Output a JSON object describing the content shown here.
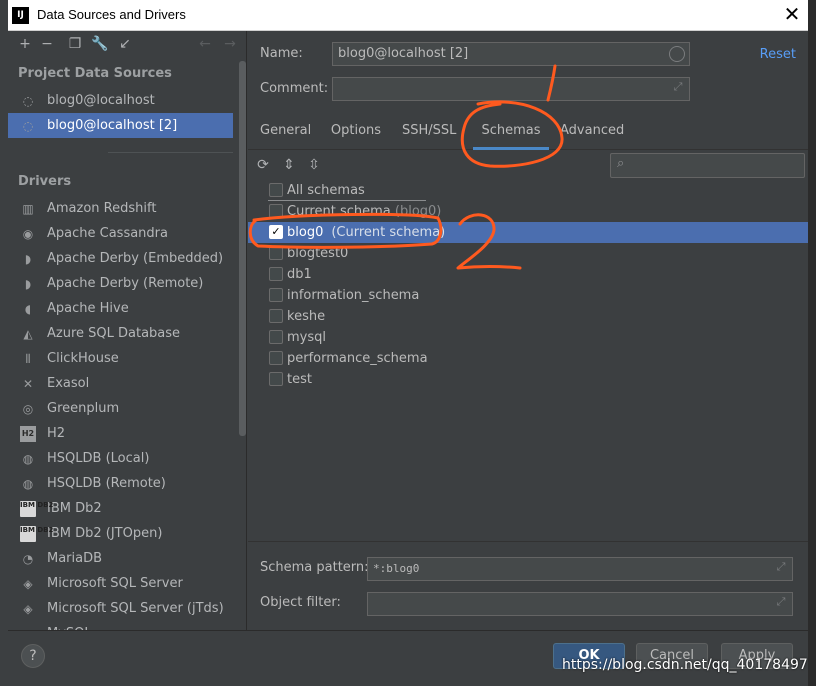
{
  "window": {
    "title": "Data Sources and Drivers",
    "app_icon": "IJ"
  },
  "sidebar": {
    "project_header": "Project Data Sources",
    "project_items": [
      {
        "label": "blog0@localhost",
        "selected": false
      },
      {
        "label": "blog0@localhost [2]",
        "selected": true
      }
    ],
    "drivers_header": "Drivers",
    "drivers": [
      {
        "label": "Amazon Redshift",
        "icon": "redshift-icon"
      },
      {
        "label": "Apache Cassandra",
        "icon": "cassandra-icon"
      },
      {
        "label": "Apache Derby (Embedded)",
        "icon": "derby-icon"
      },
      {
        "label": "Apache Derby (Remote)",
        "icon": "derby-icon"
      },
      {
        "label": "Apache Hive",
        "icon": "hive-icon"
      },
      {
        "label": "Azure SQL Database",
        "icon": "azure-icon"
      },
      {
        "label": "ClickHouse",
        "icon": "clickhouse-icon"
      },
      {
        "label": "Exasol",
        "icon": "exasol-icon"
      },
      {
        "label": "Greenplum",
        "icon": "greenplum-icon"
      },
      {
        "label": "H2",
        "icon": "h2-icon"
      },
      {
        "label": "HSQLDB (Local)",
        "icon": "hsqldb-icon"
      },
      {
        "label": "HSQLDB (Remote)",
        "icon": "hsqldb-icon"
      },
      {
        "label": "IBM Db2",
        "icon": "ibm-db2-icon"
      },
      {
        "label": "IBM Db2 (JTOpen)",
        "icon": "ibm-db2-icon"
      },
      {
        "label": "MariaDB",
        "icon": "mariadb-icon"
      },
      {
        "label": "Microsoft SQL Server",
        "icon": "mssql-icon"
      },
      {
        "label": "Microsoft SQL Server (jTds)",
        "icon": "mssql-icon"
      },
      {
        "label": "MySQL",
        "icon": "mysql-icon"
      }
    ]
  },
  "form": {
    "name_label": "Name:",
    "name_value": "blog0@localhost [2]",
    "comment_label": "Comment:",
    "comment_value": "",
    "reset_label": "Reset"
  },
  "tabs": [
    "General",
    "Options",
    "SSH/SSL",
    "Schemas",
    "Advanced"
  ],
  "active_tab": "Schemas",
  "schemas": {
    "all_schemas": "All schemas",
    "current_schema": "Current schema",
    "current_schema_hint": "(blog0)",
    "items": [
      {
        "name": "blog0",
        "hint": "(Current schema)",
        "checked": true,
        "selected": true
      },
      {
        "name": "blogtest0",
        "hint": "",
        "checked": false,
        "selected": false
      },
      {
        "name": "db1",
        "hint": "",
        "checked": false,
        "selected": false
      },
      {
        "name": "information_schema",
        "hint": "",
        "checked": false,
        "selected": false
      },
      {
        "name": "keshe",
        "hint": "",
        "checked": false,
        "selected": false
      },
      {
        "name": "mysql",
        "hint": "",
        "checked": false,
        "selected": false
      },
      {
        "name": "performance_schema",
        "hint": "",
        "checked": false,
        "selected": false
      },
      {
        "name": "test",
        "hint": "",
        "checked": false,
        "selected": false
      }
    ]
  },
  "bottom": {
    "schema_pattern_label": "Schema pattern:",
    "schema_pattern_value": "*:blog0",
    "object_filter_label": "Object filter:",
    "object_filter_value": ""
  },
  "footer": {
    "help": "?",
    "ok": "OK",
    "cancel": "Cancel",
    "apply": "Apply"
  },
  "annotations": {
    "one": "1",
    "two": "2",
    "color": "#ff5a1f"
  },
  "watermark": "https://blog.csdn.net/qq_40178497"
}
